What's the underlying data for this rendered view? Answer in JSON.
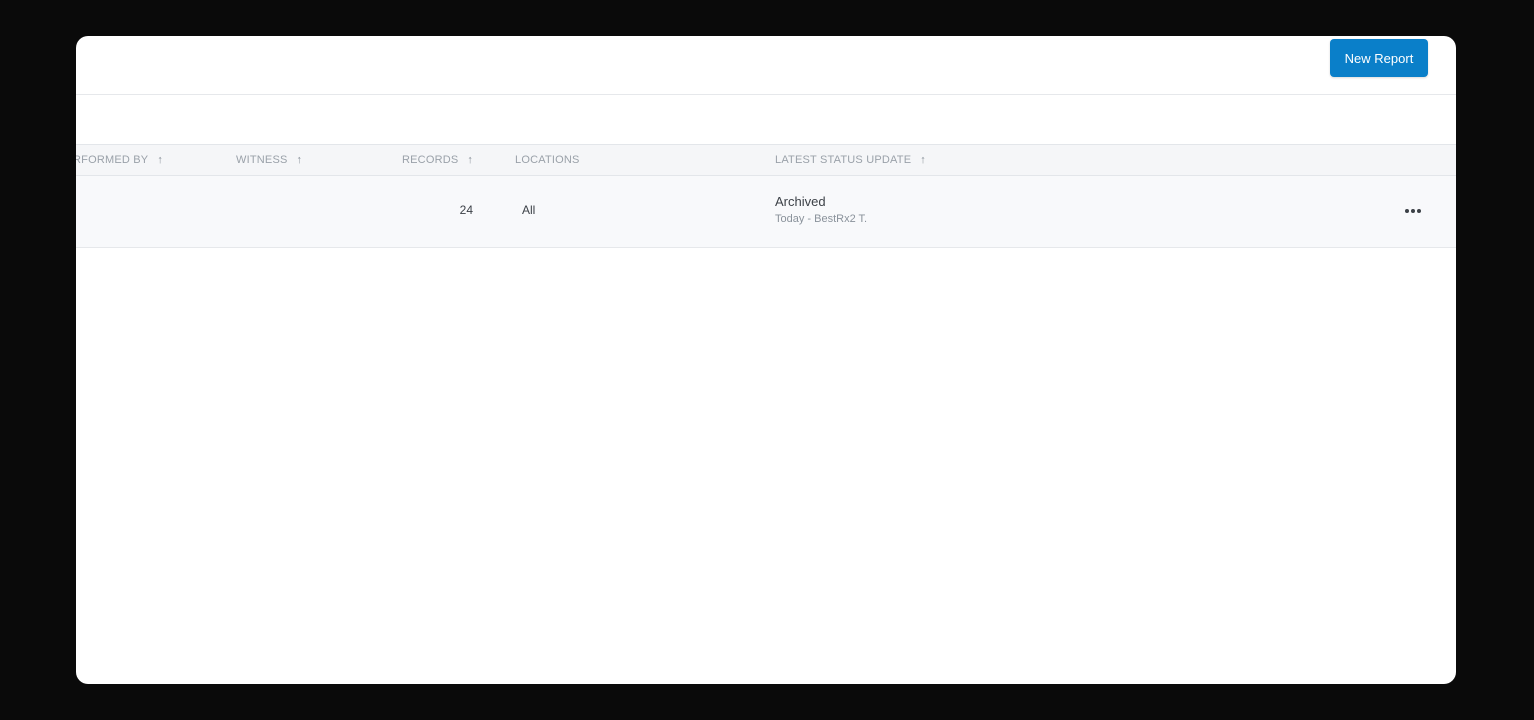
{
  "header": {
    "new_report_label": "New Report"
  },
  "table": {
    "columns": [
      {
        "label": "RFORMED BY",
        "sortable": true
      },
      {
        "label": "WITNESS",
        "sortable": true
      },
      {
        "label": "RECORDS",
        "sortable": true
      },
      {
        "label": "LOCATIONS",
        "sortable": false
      },
      {
        "label": "LATEST STATUS UPDATE",
        "sortable": true
      }
    ],
    "sort_arrow": "↑",
    "rows": [
      {
        "performed_by": "",
        "witness": "",
        "records": "24",
        "locations": "All",
        "status": "Archived",
        "status_detail": "Today - BestRx2 T."
      }
    ]
  },
  "colors": {
    "accent": "#0a7fc9",
    "header_bg": "#f5f6f8",
    "row_bg": "#f8f9fb",
    "backdrop": "#0a0a0a"
  },
  "icons": {
    "sort": "arrow-up-icon",
    "row_actions": "more-horizontal-icon"
  }
}
